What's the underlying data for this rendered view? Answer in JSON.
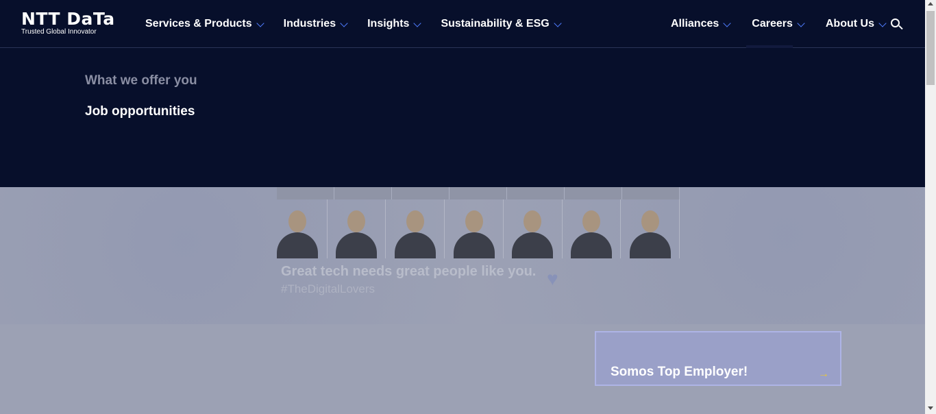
{
  "brand": {
    "name": "NTT DaTa",
    "tagline": "Trusted Global Innovator"
  },
  "nav_left": [
    {
      "label": "Services & Products"
    },
    {
      "label": "Industries"
    },
    {
      "label": "Insights"
    },
    {
      "label": "Sustainability & ESG"
    }
  ],
  "nav_right": [
    {
      "label": "Alliances"
    },
    {
      "label": "Careers"
    },
    {
      "label": "About Us"
    }
  ],
  "icons": {
    "search": "search-icon",
    "chevron": "chevron-down-icon",
    "arrow": "arrow-right-icon"
  },
  "dropdown": {
    "items": [
      {
        "label": "What we offer you"
      },
      {
        "label": "Job opportunities"
      }
    ]
  },
  "hero": {
    "headline": "Great tech needs great people like you.",
    "hashtag": "#TheDigitalLovers",
    "promo_card": {
      "title": "Somos Top Employer!",
      "arrow": "→"
    }
  },
  "colors": {
    "header_bg": "#070f2b",
    "accent_chevron": "#4f7cff",
    "overlay": "#9ca1b4",
    "promo_arrow": "#e8c53a"
  }
}
